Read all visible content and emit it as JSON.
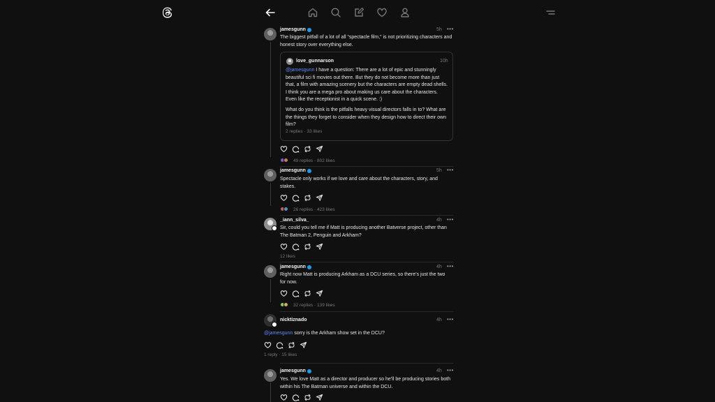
{
  "nav": {
    "icons": [
      "threads-logo-icon",
      "back-arrow-icon",
      "home-icon",
      "search-icon",
      "compose-icon",
      "heart-icon",
      "profile-icon",
      "menu-icon"
    ]
  },
  "posts": [
    {
      "user": "jamesgunn",
      "time": "5h",
      "text": "The biggest pitfall of a lot of all “spectacle film,” is not prioritizing characters and honest story over everything else.",
      "meta": "49 replies · 802 likes",
      "quote": {
        "user": "love_gunnarson",
        "time": "10h",
        "mention": "@jamesgunn",
        "text1": " I have a question: There are a lot of epic and stunningly beautiful sci fi movies out there. But they do not become more than just that, a film with amazing scenery but the characters are empty dead shells. I think you are a mega pro about making us care about the characters. Even like the receptionist in a quick scene. :)",
        "text2": "What do you think is the pitfalls heavy visual directors falls in to? What are the things they forget to consider when they design how to direct their own film?",
        "meta": "2 replies · 33 likes"
      }
    },
    {
      "user": "jamesgunn",
      "time": "5h",
      "text": "Spectacle only works if we love and care about the characters, story, and stakes.",
      "meta": "26 replies · 423 likes"
    },
    {
      "user": "_iann_silva_",
      "time": "4h",
      "text": "Sir, could you tell me if Matt is producing another Batverse project, other than The Batman 2, Penguin and Arkham?",
      "meta": "12 likes"
    },
    {
      "user": "jamesgunn",
      "time": "4h",
      "text": "Right now Matt is producing Arkham as a DCU series, so there’s just the two for now.",
      "meta": "32 replies · 139 likes"
    },
    {
      "user": "nicktiznado",
      "time": "4h",
      "mention": "@jamesgunn",
      "text": " sorry is the Arkham show set in the DCU?",
      "meta": "1 reply · 15 likes"
    },
    {
      "user": "jamesgunn",
      "time": "4h",
      "text": "Yes. We love Matt as a director and producer so he’ll be producing stories both within his The Batman universe and within the DCU."
    }
  ],
  "more": "•••"
}
